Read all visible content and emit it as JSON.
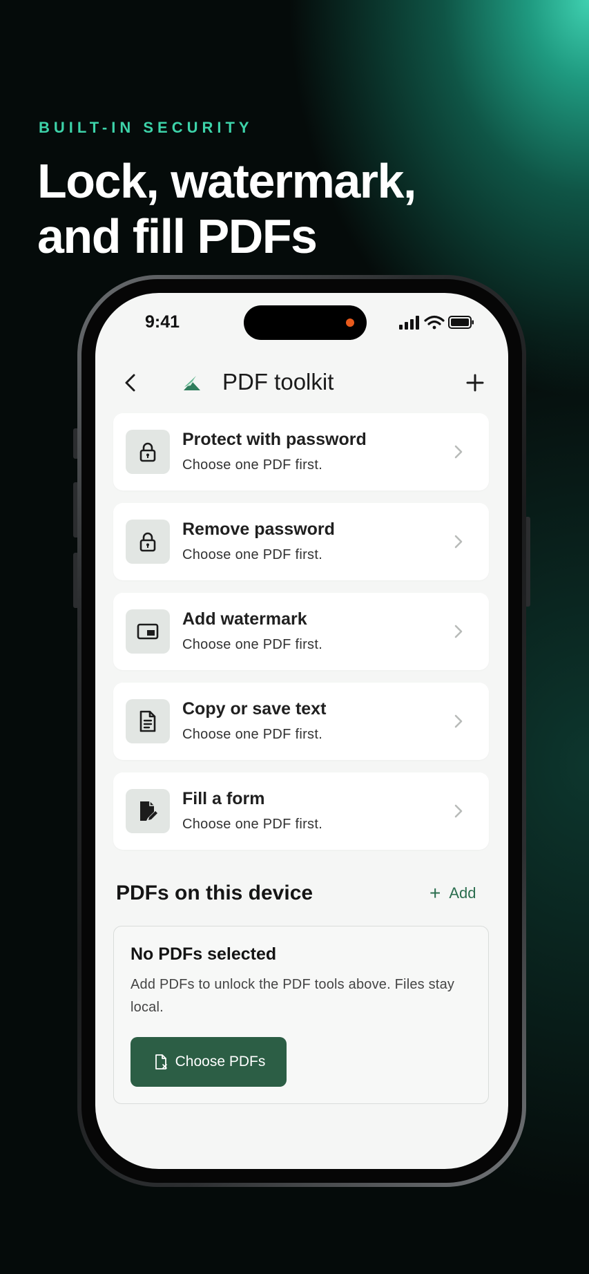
{
  "promo": {
    "eyebrow": "BUILT-IN SECURITY",
    "headline_line1": "Lock, watermark,",
    "headline_line2": "and fill PDFs"
  },
  "status_bar": {
    "time": "9:41"
  },
  "nav": {
    "title": "PDF toolkit"
  },
  "tools": [
    {
      "title": "Protect with password",
      "subtitle": "Choose one PDF first.",
      "icon": "lock-icon"
    },
    {
      "title": "Remove password",
      "subtitle": "Choose one PDF first.",
      "icon": "lock-icon"
    },
    {
      "title": "Add watermark",
      "subtitle": "Choose one PDF first.",
      "icon": "watermark-icon"
    },
    {
      "title": "Copy or save text",
      "subtitle": "Choose one PDF first.",
      "icon": "document-text-icon"
    },
    {
      "title": "Fill a form",
      "subtitle": "Choose one PDF first.",
      "icon": "form-edit-icon"
    }
  ],
  "device_section": {
    "title": "PDFs on this device",
    "add_label": "Add",
    "empty_title": "No PDFs selected",
    "empty_body": "Add PDFs to unlock the PDF tools above. Files stay local.",
    "choose_button": "Choose PDFs"
  },
  "colors": {
    "accent": "#2c5e45",
    "eyebrow": "#3dd3a9",
    "screen_bg": "#f5f6f5"
  }
}
